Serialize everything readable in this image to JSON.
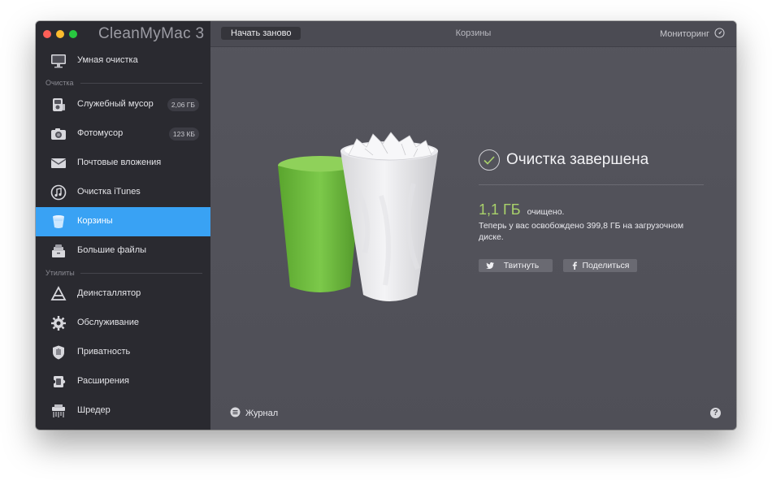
{
  "app": {
    "title": "CleanMyMac 3"
  },
  "sidebar": {
    "top_item": {
      "label": "Умная очистка",
      "icon": "monitor-icon"
    },
    "sections": [
      {
        "label": "Очистка"
      },
      {
        "label": "Утилиты"
      }
    ],
    "cleanup_items": [
      {
        "label": "Служебный мусор",
        "badge": "2,06 ГБ",
        "icon": "system-junk-icon"
      },
      {
        "label": "Фотомусор",
        "badge": "123 КБ",
        "icon": "camera-icon"
      },
      {
        "label": "Почтовые вложения",
        "icon": "mail-icon"
      },
      {
        "label": "Очистка iTunes",
        "icon": "itunes-icon"
      },
      {
        "label": "Корзины",
        "icon": "trash-bin-icon",
        "active": true
      },
      {
        "label": "Большие файлы",
        "icon": "large-files-icon"
      }
    ],
    "utility_items": [
      {
        "label": "Деинсталлятор",
        "icon": "uninstaller-icon"
      },
      {
        "label": "Обслуживание",
        "icon": "maintenance-gear-icon"
      },
      {
        "label": "Приватность",
        "icon": "privacy-shield-icon"
      },
      {
        "label": "Расширения",
        "icon": "extensions-puzzle-icon"
      },
      {
        "label": "Шредер",
        "icon": "shredder-icon"
      }
    ]
  },
  "toolbar": {
    "restart_label": "Начать заново",
    "title": "Корзины",
    "monitoring_label": "Мониторинг"
  },
  "result": {
    "title": "Очистка завершена",
    "freed_size": "1,1 ГБ",
    "freed_word": "очищено.",
    "description": "Теперь у вас освобождено 399,8 ГБ на загрузочном диске.",
    "tweet_label": "Твитнуть",
    "share_label": "Поделиться"
  },
  "footer": {
    "journal_label": "Журнал",
    "help_label": "?"
  },
  "colors": {
    "sidebar_bg": "#2a2a30",
    "main_bg": "#55555d",
    "active_item": "#39a2f4",
    "freed_size": "#a9d26b",
    "bin_green": "#6bb83a"
  }
}
